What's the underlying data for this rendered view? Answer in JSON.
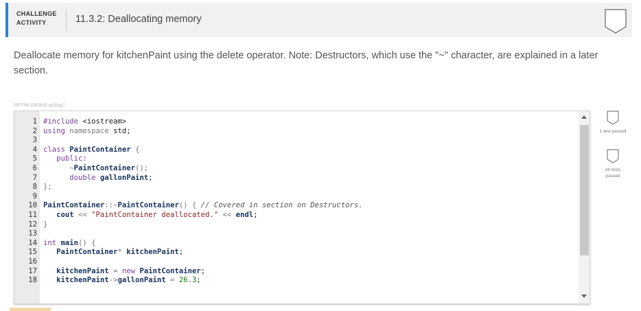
{
  "header": {
    "tag_line1": "CHALLENGE",
    "tag_line2": "ACTIVITY",
    "title": "11.3.2: Deallocating memory"
  },
  "instructions": "Deallocate memory for kitchenPaint using the delete operator. Note: Destructors, which use the \"~\" character, are explained in a later section.",
  "challenge_id": "397756.2392630.qx3zqy7",
  "tests": [
    {
      "label": "1 test passed"
    },
    {
      "label": "All tests passed"
    }
  ],
  "code_lines": [
    {
      "n": "1",
      "tokens": [
        [
          "kw",
          "#include "
        ],
        [
          "pl",
          "<iostream>"
        ]
      ]
    },
    {
      "n": "2",
      "tokens": [
        [
          "kw",
          "using "
        ],
        [
          "op",
          "namespace "
        ],
        [
          "pl",
          "std;"
        ]
      ]
    },
    {
      "n": "3",
      "tokens": []
    },
    {
      "n": "4",
      "tokens": [
        [
          "kw",
          "class "
        ],
        [
          "ty",
          "PaintContainer "
        ],
        [
          "op",
          "{"
        ]
      ]
    },
    {
      "n": "5",
      "tokens": [
        [
          "kw",
          "   public:"
        ]
      ]
    },
    {
      "n": "6",
      "tokens": [
        [
          "op",
          "      ~"
        ],
        [
          "ty",
          "PaintContainer"
        ],
        [
          "op",
          "();"
        ]
      ]
    },
    {
      "n": "7",
      "tokens": [
        [
          "kw",
          "      double "
        ],
        [
          "ty",
          "gallonPaint"
        ],
        [
          "pl",
          ";"
        ]
      ]
    },
    {
      "n": "8",
      "tokens": [
        [
          "op",
          "};"
        ]
      ]
    },
    {
      "n": "9",
      "tokens": []
    },
    {
      "n": "10",
      "tokens": [
        [
          "ty",
          "PaintContainer"
        ],
        [
          "op",
          "::~"
        ],
        [
          "ty",
          "PaintContainer"
        ],
        [
          "op",
          "() { "
        ],
        [
          "cm",
          "// Covered in section on Destructors."
        ]
      ]
    },
    {
      "n": "11",
      "tokens": [
        [
          "ty",
          "   cout "
        ],
        [
          "op",
          "<< "
        ],
        [
          "str",
          "\"PaintContainer deallocated.\" "
        ],
        [
          "op",
          "<< "
        ],
        [
          "ty",
          "endl"
        ],
        [
          "pl",
          ";"
        ]
      ]
    },
    {
      "n": "12",
      "tokens": [
        [
          "op",
          "}"
        ]
      ]
    },
    {
      "n": "13",
      "tokens": []
    },
    {
      "n": "14",
      "tokens": [
        [
          "kw",
          "int "
        ],
        [
          "ty",
          "main"
        ],
        [
          "op",
          "() {"
        ]
      ]
    },
    {
      "n": "15",
      "tokens": [
        [
          "ty",
          "   PaintContainer"
        ],
        [
          "op",
          "* "
        ],
        [
          "ty",
          "kitchenPaint"
        ],
        [
          "pl",
          ";"
        ]
      ]
    },
    {
      "n": "16",
      "tokens": []
    },
    {
      "n": "17",
      "tokens": [
        [
          "ty",
          "   kitchenPaint "
        ],
        [
          "op",
          "= "
        ],
        [
          "kw",
          "new "
        ],
        [
          "ty",
          "PaintContainer"
        ],
        [
          "pl",
          ";"
        ]
      ]
    },
    {
      "n": "18",
      "tokens": [
        [
          "ty",
          "   kitchenPaint"
        ],
        [
          "op",
          "->"
        ],
        [
          "ty",
          "gallonPaint "
        ],
        [
          "op",
          "= "
        ],
        [
          "num",
          "26.3"
        ],
        [
          "pl",
          ";"
        ]
      ]
    }
  ],
  "colors": {
    "accent": "#2f80d1"
  }
}
